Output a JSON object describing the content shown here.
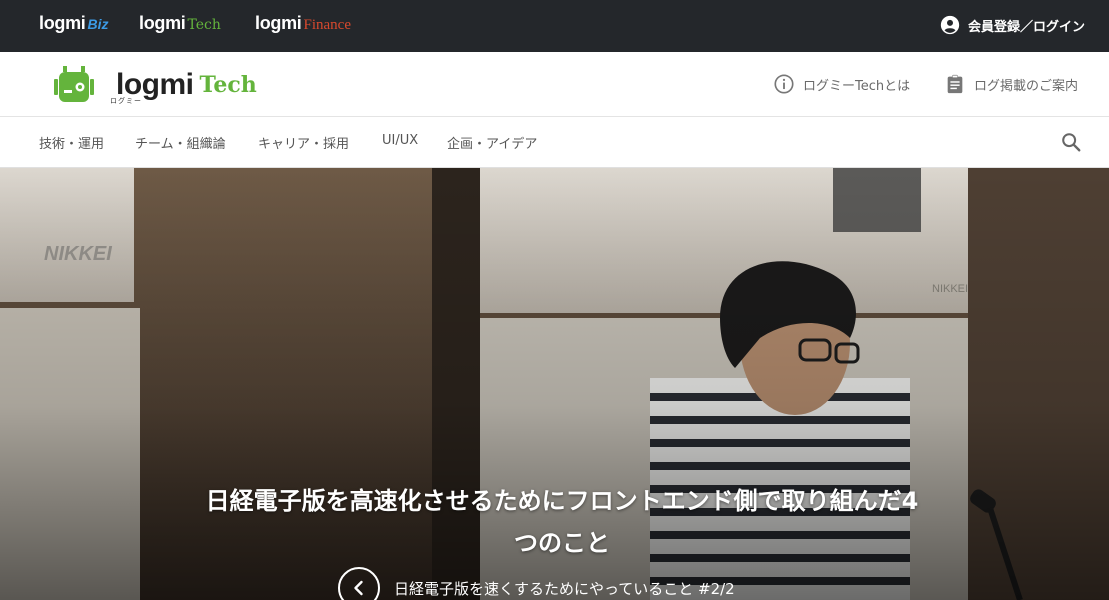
{
  "topbar": {
    "brands": [
      {
        "main": "logmi",
        "suffix": "Biz"
      },
      {
        "main": "logmi",
        "suffix": "Tech"
      },
      {
        "main": "logmi",
        "suffix": "Finance"
      }
    ],
    "login_label": "会員登録／ログイン"
  },
  "header": {
    "logo_main": "logmi",
    "logo_kana": "ログミー",
    "logo_sub": "Tech",
    "about_label": "ログミーTechとは",
    "guide_label": "ログ掲載のご案内"
  },
  "nav": {
    "categories": [
      "技術・運用",
      "チーム・組織論",
      "キャリア・採用",
      "UI/UX",
      "企画・アイデア"
    ]
  },
  "hero": {
    "title": "日経電子版を高速化させるためにフロントエンド側で取り組んだ4つのこと",
    "series": "日経電子版を速くするためにやっていること #2/2",
    "screen_label_left": "NIKKEI",
    "screen_label_right": "NIKKEI"
  },
  "colors": {
    "topbar": "#24272b",
    "biz_accent": "#3c9be6",
    "tech_accent": "#64b43c",
    "finance_accent": "#d7492e"
  },
  "icons": {
    "user": "account-circle-icon",
    "info": "info-circle-icon",
    "clipboard": "clipboard-icon",
    "search": "search-icon",
    "prev": "chevron-left-icon"
  }
}
